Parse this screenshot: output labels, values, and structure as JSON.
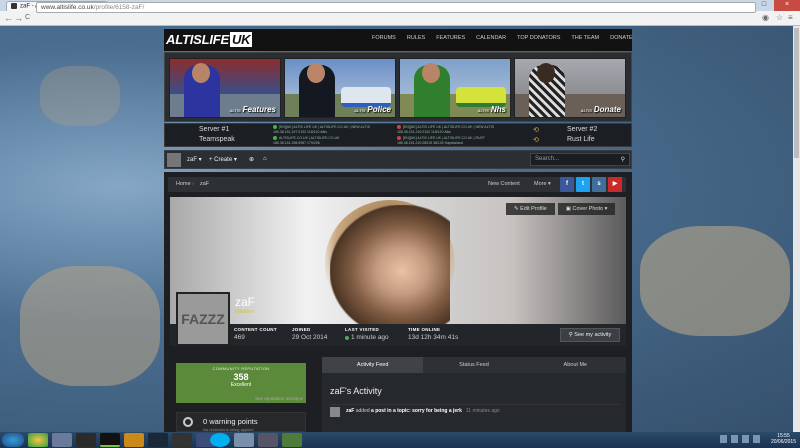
{
  "browser": {
    "tab_title": "zaF - Altis Life",
    "tab_close": "×",
    "url_host": "www.altislife.co.uk",
    "url_path": "/profile/6158-zaF/",
    "back": "←",
    "forward": "→",
    "reload": "C",
    "win_min": "–",
    "win_max": "□",
    "win_close": "×"
  },
  "site": {
    "logo_main": "ALTISLIFE",
    "logo_uk": "UK",
    "nav": [
      "FORUMS",
      "RULES",
      "FEATURES",
      "CALENDAR",
      "TOP DONATORS",
      "THE TEAM",
      "DONATE"
    ]
  },
  "banner": [
    {
      "small": "ALTIS",
      "label": "Features"
    },
    {
      "small": "ALTIS",
      "label": "Police"
    },
    {
      "small": "ALTIS",
      "label": "Nhs"
    },
    {
      "small": "ALTIS",
      "label": "Donate"
    }
  ],
  "servers": {
    "server1_label": "Server #1",
    "teamspeak_label": "Teamspeak",
    "server2_label": "Server #2",
    "rust_label": "Rust Life",
    "s1_name": "[EN][UK] ALTIS LIFE UK | ALTISLIFE.CO.UK | NEW ALTIS",
    "s1_info": "185.38.151.197:2102    118/120    Altis",
    "ts_name": "ALTISLIFE.CO.UK | ALTISLIFE.CO.UK",
    "ts_info": "185.38.151.198:9987    179/256",
    "s2_name": "[EN][UK] ALTIS LIFE UK | ALTISLIFE.CO.UK | NEW ALTIS",
    "s2_info": "185.38.151.210:2102    118/120    Altis",
    "rust_name": "[EN][UK] ALTIS LIFE UK | ALTISLIFE.CO.UK | RUST",
    "rust_info": "185.38.151.210:28015    38/100    Hapisisland"
  },
  "userbar": {
    "username": "zaF ▾",
    "create": "+ Create ▾",
    "search_placeholder": "Search..."
  },
  "breadcrumb": {
    "home": "Home",
    "current": "zaF"
  },
  "crumb_actions": {
    "new_content": "New Content",
    "more": "More ▾"
  },
  "profile": {
    "edit_profile": "Edit Profile",
    "cover_photo": "Cover Photo ▾",
    "avatar_text": "FAZZZ",
    "name": "zaF",
    "rank": "Minidex",
    "stats": [
      {
        "label": "CONTENT COUNT",
        "value": "469"
      },
      {
        "label": "JOINED",
        "value": "29 Oct 2014"
      },
      {
        "label": "LAST VISITED",
        "value": "1 minute ago"
      },
      {
        "label": "TIME ONLINE",
        "value": "13d 12h 34m 41s"
      }
    ],
    "see_activity": "See my activity"
  },
  "reputation": {
    "label": "COMMUNITY REPUTATION",
    "value": "358",
    "status": "Excellent",
    "link": "See reputation activity ▸"
  },
  "warnings": {
    "title": "0 warning points",
    "sub": "No restrictions being applied"
  },
  "tabs": [
    "Activity Feed",
    "Status Feed",
    "About Me"
  ],
  "feed": {
    "title": "zaF's Activity",
    "item_user": "zaF",
    "item_text": " added ",
    "item_link": "a post in a topic: sorry for being a jerk",
    "item_time": "11 minutes ago"
  },
  "clock": {
    "time": "15:55",
    "date": "20/06/2015"
  },
  "colors": {
    "rep_green": "#5b8a3a",
    "rank_yellow": "#d7c333",
    "facebook": "#3b5998",
    "twitter": "#1da1f2",
    "steam": "#3f6f9a",
    "youtube": "#cc2a2a"
  }
}
